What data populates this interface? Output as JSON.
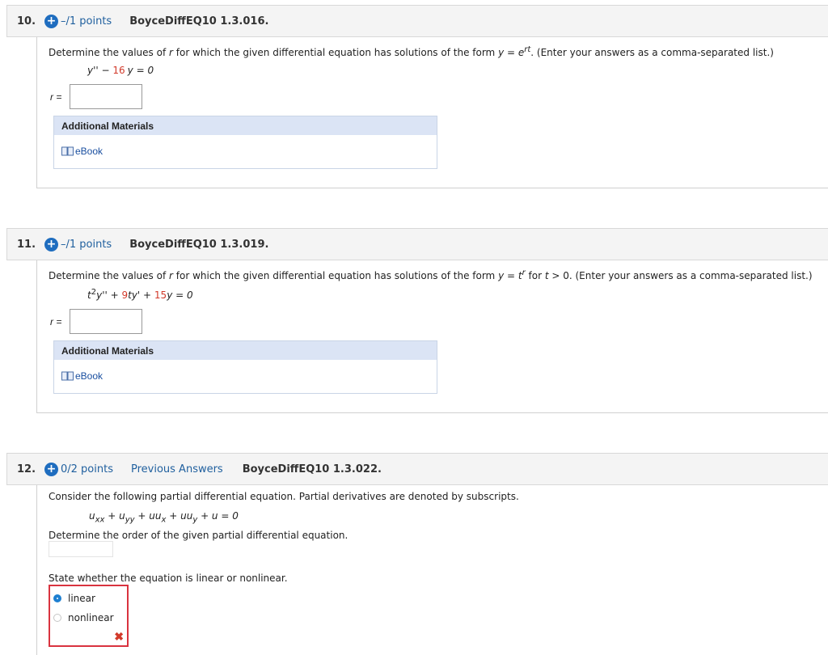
{
  "questions": [
    {
      "number": "10.",
      "points": "–/1 points",
      "id": "BoyceDiffEQ10 1.3.016.",
      "prompt_start": "Determine the values of ",
      "prompt_var": "r",
      "prompt_mid": " for which the given differential equation has solutions of the form ",
      "form": "y = e",
      "form_sup": "rt",
      "prompt_end": ".  (Enter your answers as a comma-separated list.)",
      "eq_part1": "y'' − ",
      "eq_coef": "16",
      "eq_part2": "y = 0",
      "answer_label": "r =",
      "answer_value": "",
      "additional_materials": "Additional Materials",
      "ebook": "eBook"
    },
    {
      "number": "11.",
      "points": "–/1 points",
      "id": "BoyceDiffEQ10 1.3.019.",
      "prompt_start": "Determine the values of ",
      "prompt_var": "r",
      "prompt_mid": " for which the given differential equation has solutions of the form ",
      "form": "y = t",
      "form_sup": "r",
      "form_cond": " for ",
      "form_t": "t",
      "form_cond2": " > 0.",
      "prompt_end": "  (Enter your answers as a comma-separated list.)",
      "eq_t": "t",
      "eq_t_sup": "2",
      "eq_part1": "y'' + ",
      "eq_coef1": "9",
      "eq_part2": "ty' + ",
      "eq_coef2": "15",
      "eq_part3": "y = 0",
      "answer_label": "r =",
      "answer_value": "",
      "additional_materials": "Additional Materials",
      "ebook": "eBook"
    },
    {
      "number": "12.",
      "points": "0/2 points",
      "previous_answers": "Previous Answers",
      "id": "BoyceDiffEQ10 1.3.022.",
      "prompt": "Consider the following partial differential equation. Partial derivatives are denoted by subscripts.",
      "pde": "u_xx + u_yy + uu_x + uu_y + u = 0",
      "order_prompt": "Determine the order of the given partial differential equation.",
      "order_value": "",
      "linear_prompt": "State whether the equation is linear or nonlinear.",
      "options": [
        "linear",
        "nonlinear"
      ],
      "selected_option": "linear",
      "result": "incorrect"
    }
  ],
  "colors": {
    "accent": "#1f6dbf",
    "link": "#1f5f9e",
    "coefficient_red": "#d23a2b",
    "header_bg": "#f4f4f4",
    "materials_head": "#dbe4f5",
    "error_border": "#d9333f"
  },
  "icons": [
    "plus-circle-icon",
    "book-icon",
    "x-mark-icon"
  ]
}
